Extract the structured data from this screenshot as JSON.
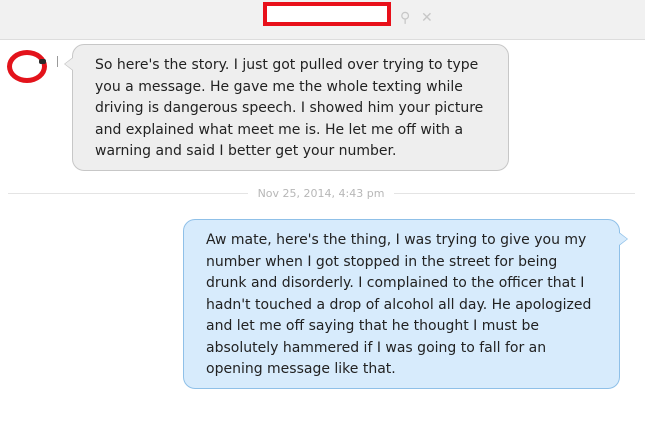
{
  "header": {
    "pin_icon": "pin-icon",
    "close_icon": "close-icon"
  },
  "messages": [
    {
      "direction": "incoming",
      "text": "So here's the story. I just got pulled over trying to type you a message. He gave me the whole texting while driving is dangerous speech. I showed him your picture and explained what meet me is. He let me off with a warning and said I better get your number."
    },
    {
      "direction": "outgoing",
      "text": "Aw mate, here's the thing, I was trying to give you my number when I got stopped in the street for being drunk and disorderly. I complained to the officer that I hadn't touched a drop of alcohol all day. He apologized and let me off saying that he thought I must be absolutely hammered if I was going to fall for an opening message like that."
    }
  ],
  "timestamp": "Nov 25, 2014, 4:43 pm",
  "colors": {
    "redaction": "#e8101a",
    "incoming_bubble": "#eeeeee",
    "outgoing_bubble": "#d7ebfc",
    "outgoing_border": "#8fc0e8"
  }
}
